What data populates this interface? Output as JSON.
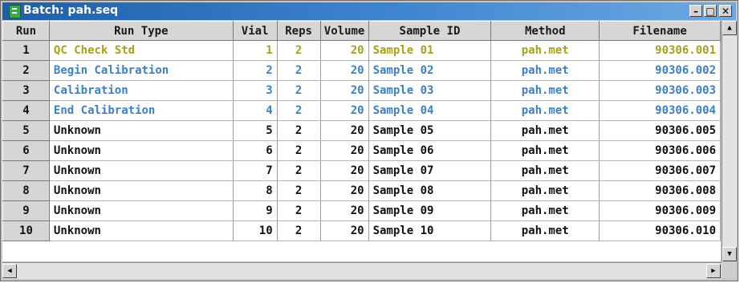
{
  "window": {
    "title": "Batch: pah.seq"
  },
  "columns": [
    "Run",
    "Run Type",
    "Vial",
    "Reps",
    "Volume",
    "Sample ID",
    "Method",
    "Filename"
  ],
  "colors": {
    "qc": "#a8a019",
    "calibration": "#3d7fc4",
    "unknown": "#111111",
    "title_bar": "#2f6fbd"
  },
  "rows": [
    {
      "run": "1",
      "run_type": "QC Check Std",
      "vial": "1",
      "reps": "2",
      "volume": "20",
      "sample_id": "Sample 01",
      "method": "pah.met",
      "filename": "90306.001",
      "category": "qc"
    },
    {
      "run": "2",
      "run_type": "Begin Calibration",
      "vial": "2",
      "reps": "2",
      "volume": "20",
      "sample_id": "Sample 02",
      "method": "pah.met",
      "filename": "90306.002",
      "category": "calibration"
    },
    {
      "run": "3",
      "run_type": "Calibration",
      "vial": "3",
      "reps": "2",
      "volume": "20",
      "sample_id": "Sample 03",
      "method": "pah.met",
      "filename": "90306.003",
      "category": "calibration"
    },
    {
      "run": "4",
      "run_type": "End Calibration",
      "vial": "4",
      "reps": "2",
      "volume": "20",
      "sample_id": "Sample 04",
      "method": "pah.met",
      "filename": "90306.004",
      "category": "calibration"
    },
    {
      "run": "5",
      "run_type": "Unknown",
      "vial": "5",
      "reps": "2",
      "volume": "20",
      "sample_id": "Sample 05",
      "method": "pah.met",
      "filename": "90306.005",
      "category": "unknown"
    },
    {
      "run": "6",
      "run_type": "Unknown",
      "vial": "6",
      "reps": "2",
      "volume": "20",
      "sample_id": "Sample 06",
      "method": "pah.met",
      "filename": "90306.006",
      "category": "unknown"
    },
    {
      "run": "7",
      "run_type": "Unknown",
      "vial": "7",
      "reps": "2",
      "volume": "20",
      "sample_id": "Sample 07",
      "method": "pah.met",
      "filename": "90306.007",
      "category": "unknown"
    },
    {
      "run": "8",
      "run_type": "Unknown",
      "vial": "8",
      "reps": "2",
      "volume": "20",
      "sample_id": "Sample 08",
      "method": "pah.met",
      "filename": "90306.008",
      "category": "unknown"
    },
    {
      "run": "9",
      "run_type": "Unknown",
      "vial": "9",
      "reps": "2",
      "volume": "20",
      "sample_id": "Sample 09",
      "method": "pah.met",
      "filename": "90306.009",
      "category": "unknown"
    },
    {
      "run": "10",
      "run_type": "Unknown",
      "vial": "10",
      "reps": "2",
      "volume": "20",
      "sample_id": "Sample 10",
      "method": "pah.met",
      "filename": "90306.010",
      "category": "unknown"
    }
  ],
  "icons": {
    "minimize": "minimize-icon",
    "maximize": "maximize-icon",
    "close": "close-icon",
    "scroll_up": "arrow-up-icon",
    "scroll_down": "arrow-down-icon",
    "scroll_left": "arrow-left-icon",
    "scroll_right": "arrow-right-icon"
  }
}
